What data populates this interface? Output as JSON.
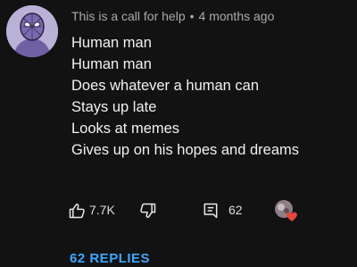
{
  "comment": {
    "author": "This is a call for help",
    "separator": "•",
    "time_ago": "4 months ago",
    "lines": [
      "Human man",
      "Human man",
      "Does whatever a human can",
      "Stays up late",
      "Looks at memes",
      "Gives up on his hopes and dreams"
    ]
  },
  "actions": {
    "like_count": "7.7K",
    "reply_count": "62",
    "like_icon": "thumbs-up-icon",
    "dislike_icon": "thumbs-down-icon",
    "reply_icon": "reply-comment-icon",
    "heart_icon": "creator-heart-icon"
  },
  "replies": {
    "label": "62 REPLIES"
  },
  "colors": {
    "background": "#121212",
    "text": "#f1f1f1",
    "meta": "#aaaaaa",
    "link": "#3ea6ff",
    "heart": "#e5483a",
    "avatar_bg": "#b9b1d6"
  }
}
